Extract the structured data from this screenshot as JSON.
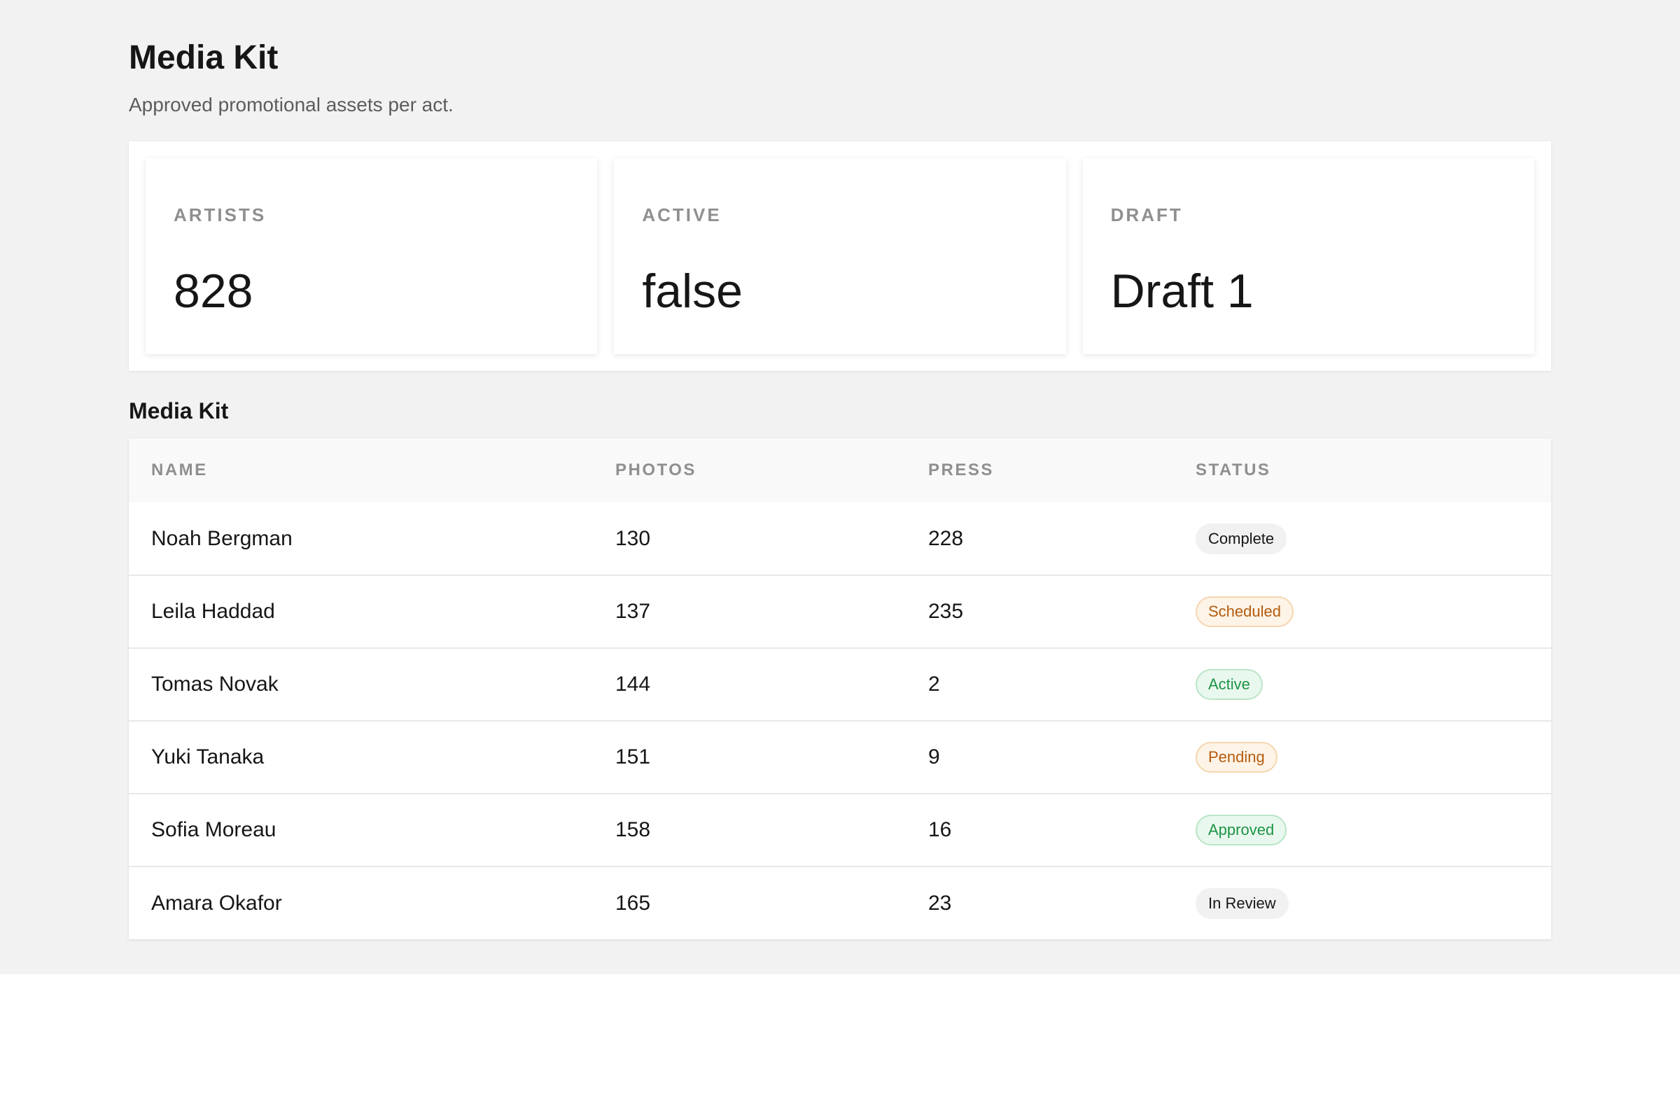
{
  "header": {
    "title": "Media Kit",
    "subtitle": "Approved promotional assets per act."
  },
  "stats": [
    {
      "label": "ARTISTS",
      "value": "828"
    },
    {
      "label": "ACTIVE",
      "value": "false"
    },
    {
      "label": "DRAFT",
      "value": "Draft 1"
    }
  ],
  "table": {
    "title": "Media Kit",
    "columns": [
      "NAME",
      "PHOTOS",
      "PRESS",
      "STATUS"
    ],
    "rows": [
      {
        "name": "Noah Bergman",
        "photos": "130",
        "press": "228",
        "status": "Complete",
        "status_tone": "neutral"
      },
      {
        "name": "Leila Haddad",
        "photos": "137",
        "press": "235",
        "status": "Scheduled",
        "status_tone": "warning"
      },
      {
        "name": "Tomas Novak",
        "photos": "144",
        "press": "2",
        "status": "Active",
        "status_tone": "success"
      },
      {
        "name": "Yuki Tanaka",
        "photos": "151",
        "press": "9",
        "status": "Pending",
        "status_tone": "warning"
      },
      {
        "name": "Sofia Moreau",
        "photos": "158",
        "press": "16",
        "status": "Approved",
        "status_tone": "success"
      },
      {
        "name": "Amara Okafor",
        "photos": "165",
        "press": "23",
        "status": "In Review",
        "status_tone": "neutral"
      }
    ]
  },
  "colors": {
    "page_background": "#f2f2f2",
    "success": "#1e9446",
    "warning": "#b45b0e",
    "neutral": "#161616"
  }
}
